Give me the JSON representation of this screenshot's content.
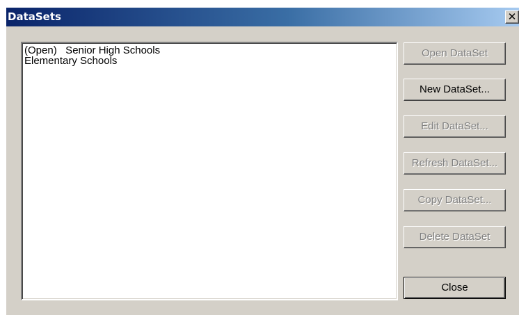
{
  "window": {
    "title": "DataSets",
    "close_glyph": "✕"
  },
  "list": {
    "items": [
      "(Open)   Senior High Schools",
      "Elementary Schools"
    ]
  },
  "buttons": {
    "open": "Open DataSet",
    "new": "New DataSet...",
    "edit": "Edit DataSet...",
    "refresh": "Refresh DataSet...",
    "copy": "Copy DataSet...",
    "delete": "Delete DataSet",
    "close": "Close"
  },
  "colors": {
    "titlebar_start": "#0a246a",
    "titlebar_end": "#a6caf0",
    "face": "#d4d0c8",
    "disabled_text": "#808080"
  }
}
